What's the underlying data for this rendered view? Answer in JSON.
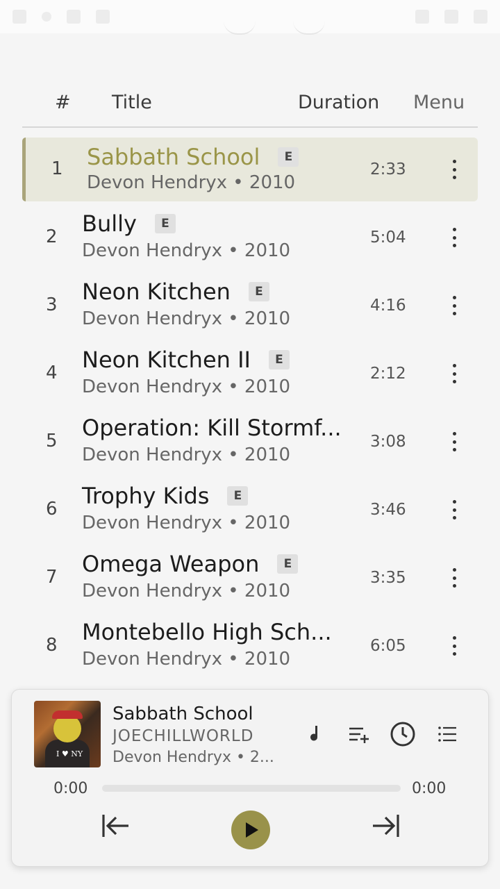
{
  "header": {
    "num_label": "#",
    "title_label": "Title",
    "duration_label": "Duration",
    "menu_label": "Menu"
  },
  "tracks": [
    {
      "num": "1",
      "title": "Sabbath School",
      "explicit": "E",
      "subtitle": "Devon Hendryx • 2010",
      "duration": "2:33",
      "active": true
    },
    {
      "num": "2",
      "title": "Bully",
      "explicit": "E",
      "subtitle": "Devon Hendryx • 2010",
      "duration": "5:04"
    },
    {
      "num": "3",
      "title": "Neon Kitchen",
      "explicit": "E",
      "subtitle": "Devon Hendryx • 2010",
      "duration": "4:16"
    },
    {
      "num": "4",
      "title": "Neon Kitchen II",
      "explicit": "E",
      "subtitle": "Devon Hendryx • 2010",
      "duration": "2:12"
    },
    {
      "num": "5",
      "title": "Operation: Kill Stormf...",
      "explicit": "",
      "subtitle": "Devon Hendryx • 2010",
      "duration": "3:08"
    },
    {
      "num": "6",
      "title": "Trophy Kids",
      "explicit": "E",
      "subtitle": "Devon Hendryx • 2010",
      "duration": "3:46"
    },
    {
      "num": "7",
      "title": "Omega Weapon",
      "explicit": "E",
      "subtitle": "Devon Hendryx • 2010",
      "duration": "3:35"
    },
    {
      "num": "8",
      "title": "Montebello High Sch...",
      "explicit": "",
      "subtitle": "Devon Hendryx • 2010",
      "duration": "6:05"
    }
  ],
  "player": {
    "title": "Sabbath School",
    "album": "JOECHILLWORLD",
    "artist": "Devon Hendryx • 2...",
    "art_text": "I ♥ NY",
    "elapsed": "0:00",
    "total": "0:00",
    "progress": 0
  },
  "colors": {
    "accent": "#99924a",
    "active_row_bg": "#e8e8dc",
    "active_title": "#9a9548"
  }
}
